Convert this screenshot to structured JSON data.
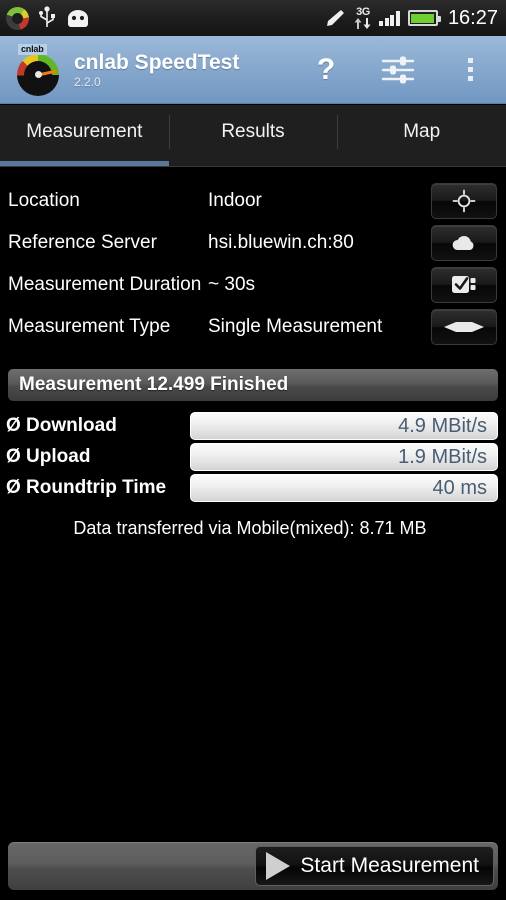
{
  "statusbar": {
    "icons_left": [
      "cnlab-status-icon",
      "usb-icon",
      "android-head-icon"
    ],
    "icons_right": [
      "satellite-icon",
      "3g-data-icon",
      "signal-bars-icon",
      "battery-icon"
    ],
    "network_label": "3G",
    "clock": "16:27"
  },
  "actionbar": {
    "app_name": "cnlab SpeedTest",
    "version": "2.2.0",
    "logo_label": "cnlab",
    "help_label": "?",
    "actions": [
      {
        "name": "help-icon",
        "label": "?"
      },
      {
        "name": "settings-sliders-icon",
        "label": ""
      },
      {
        "name": "overflow-menu-icon",
        "label": ""
      }
    ]
  },
  "tabs": [
    {
      "label": "Measurement",
      "active": true
    },
    {
      "label": "Results",
      "active": false
    },
    {
      "label": "Map",
      "active": false
    }
  ],
  "settings": {
    "rows": [
      {
        "label": "Location",
        "value": "Indoor",
        "icon": "crosshair-location-icon"
      },
      {
        "label": "Reference Server",
        "value": "hsi.bluewin.ch:80",
        "icon": "cloud-icon"
      },
      {
        "label": "Measurement Duration",
        "value": "~ 30s",
        "icon": "checklist-icon"
      },
      {
        "label": "Measurement Type",
        "value": "Single Measurement",
        "icon": "diamond-icon"
      }
    ]
  },
  "results": {
    "header": "Measurement 12.499 Finished",
    "rows": [
      {
        "label": "Ø Download",
        "value": "4.9 MBit/s"
      },
      {
        "label": "Ø Upload",
        "value": "1.9 MBit/s"
      },
      {
        "label": "Ø Roundtrip Time",
        "value": "40 ms"
      }
    ],
    "data_note": "Data transferred via Mobile(mixed): 8.71 MB"
  },
  "bottombar": {
    "start_label": "Start Measurement"
  },
  "colors": {
    "actionbar_top": "#9bb8d8",
    "actionbar_bottom": "#7197c2",
    "tab_indicator": "#5b789b",
    "value_text": "#4a5d73",
    "battery_fill": "#6fcf2e",
    "background": "#000000"
  }
}
